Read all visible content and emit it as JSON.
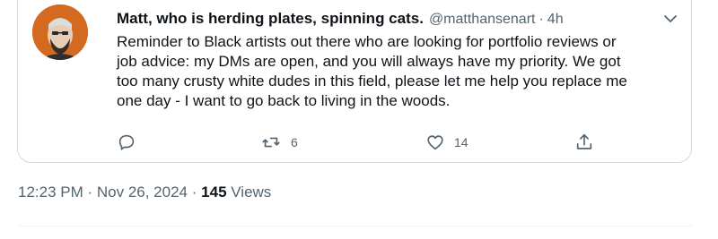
{
  "tweet": {
    "display_name": "Matt, who is herding plates, spinning cats.",
    "handle": "@matthansenart",
    "separator": "·",
    "time_ago": "4h",
    "body": "Reminder to Black artists out there who are looking for portfolio reviews or\njob advice: my DMs are open, and you will always have my priority. We got\ntoo many crusty white dudes in this field, please let me help you replace me\none day - I want to go back to living in the woods.",
    "actions": {
      "reply_icon": "reply-icon",
      "retweet_icon": "retweet-icon",
      "retweet_count": "6",
      "like_icon": "heart-icon",
      "like_count": "14",
      "share_icon": "share-icon"
    },
    "more_icon": "chevron-down-icon"
  },
  "meta": {
    "timestamp": "12:23 PM · Nov 26, 2024",
    "separator": "·",
    "views_count": "145",
    "views_label": "Views"
  },
  "colors": {
    "text_primary": "#0f1419",
    "text_secondary": "#536471",
    "border": "#cfd9de",
    "avatar_bg": "#d36a20"
  }
}
